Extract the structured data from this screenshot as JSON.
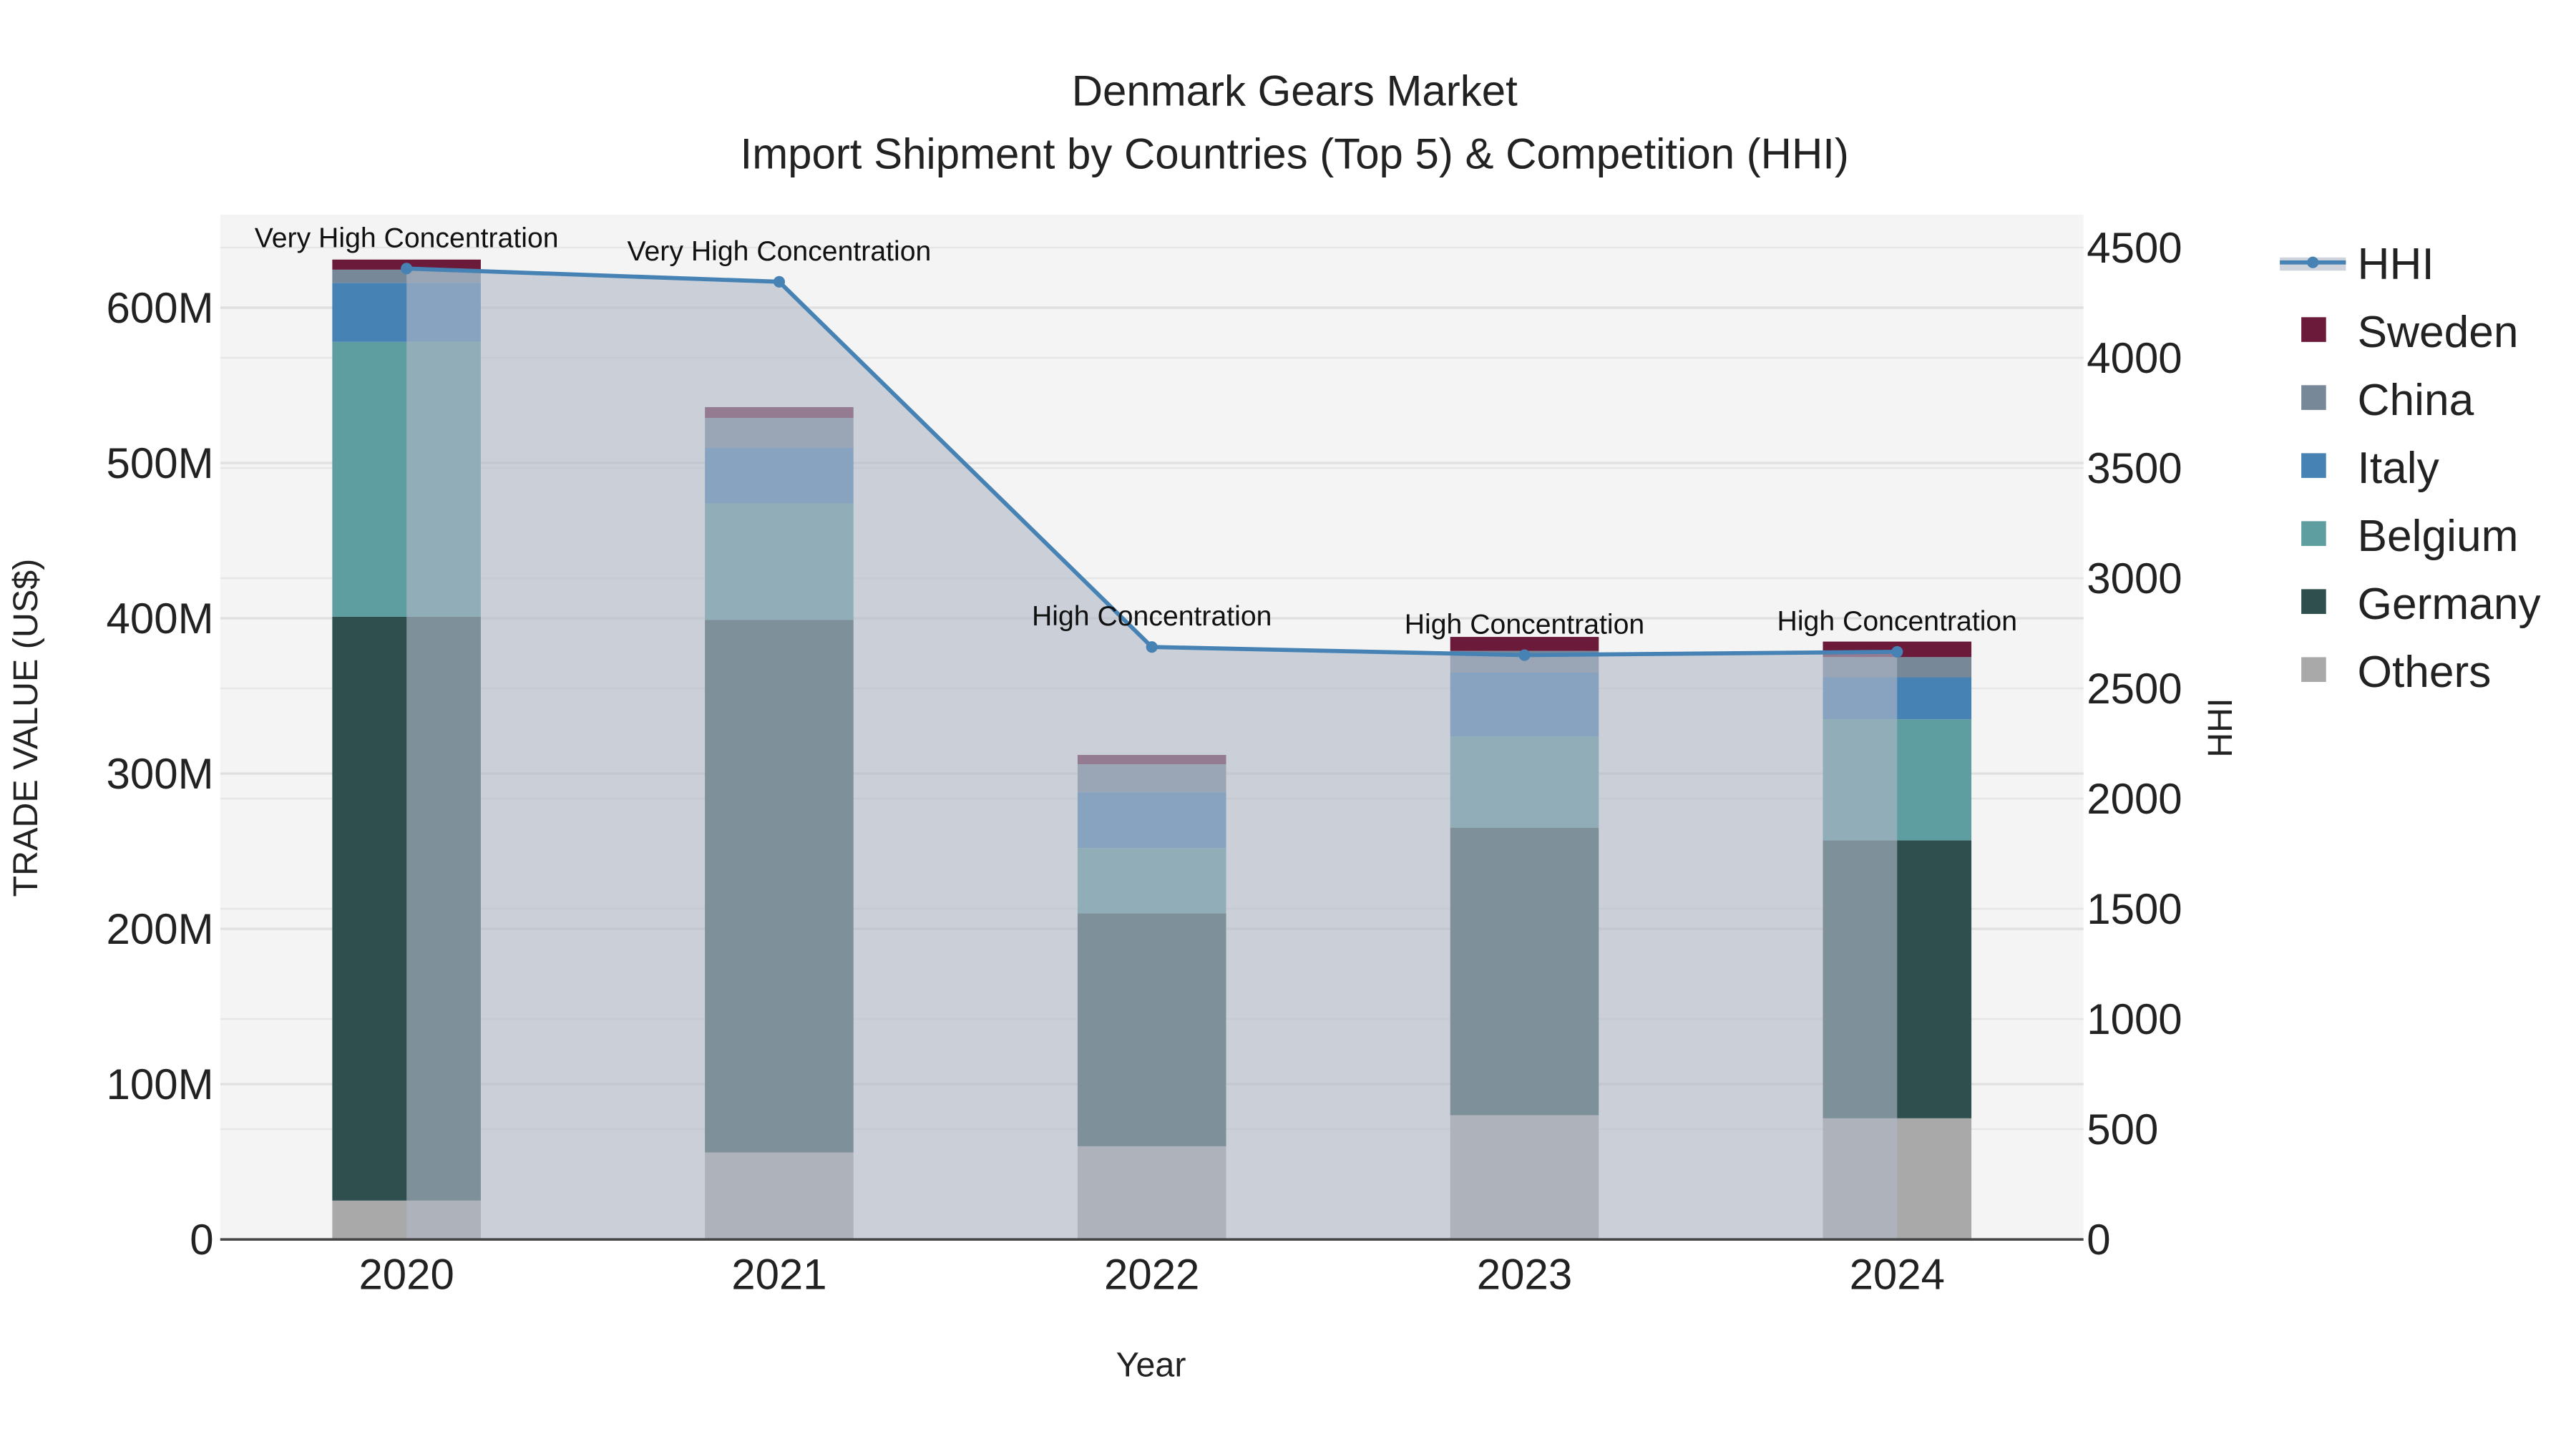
{
  "chart_data": {
    "type": "bar",
    "title": "Denmark Gears Market",
    "subtitle": "Import Shipment by Countries (Top 5) & Competition (HHI)",
    "xlabel": "Year",
    "ylabel": "TRADE VALUE (US$)",
    "y2label": "HHI",
    "categories": [
      "2020",
      "2021",
      "2022",
      "2023",
      "2024"
    ],
    "ylim": [
      0,
      660000000
    ],
    "y2lim": [
      0,
      4650
    ],
    "yticks": [
      0,
      100000000,
      200000000,
      300000000,
      400000000,
      500000000,
      600000000
    ],
    "ytick_labels": [
      "0",
      "100M",
      "200M",
      "300M",
      "400M",
      "500M",
      "600M"
    ],
    "y2ticks": [
      0,
      500,
      1000,
      1500,
      2000,
      2500,
      3000,
      3500,
      4000,
      4500
    ],
    "y2tick_labels": [
      "0",
      "500",
      "1000",
      "1500",
      "2000",
      "2500",
      "3000",
      "3500",
      "4000",
      "4500"
    ],
    "stacked": true,
    "series": [
      {
        "name": "Others",
        "color": "#a9a9a9",
        "values": [
          25000000,
          56000000,
          60000000,
          80000000,
          78000000
        ]
      },
      {
        "name": "Germany",
        "color": "#2f4f4f",
        "values": [
          376000000,
          343000000,
          150000000,
          185000000,
          179000000
        ]
      },
      {
        "name": "Belgium",
        "color": "#5f9ea0",
        "values": [
          177000000,
          75000000,
          42000000,
          59000000,
          78000000
        ]
      },
      {
        "name": "Italy",
        "color": "#4682b4",
        "values": [
          38000000,
          36000000,
          36000000,
          41000000,
          27000000
        ]
      },
      {
        "name": "China",
        "color": "#778899",
        "values": [
          8500000,
          19000000,
          18000000,
          14000000,
          13000000
        ]
      },
      {
        "name": "Sweden",
        "color": "#6b1a3a",
        "values": [
          6500000,
          7000000,
          6000000,
          9000000,
          10000000
        ]
      }
    ],
    "line": {
      "name": "HHI",
      "color": "#4682b4",
      "values": [
        4405,
        4345,
        2688,
        2651,
        2666
      ],
      "annotations": [
        "Very High Concentration",
        "Very High Concentration",
        "High Concentration",
        "High Concentration",
        "High Concentration"
      ]
    },
    "legend_order": [
      "HHI",
      "Sweden",
      "China",
      "Italy",
      "Belgium",
      "Germany",
      "Others"
    ],
    "legend_placement": "right",
    "grid": true
  }
}
